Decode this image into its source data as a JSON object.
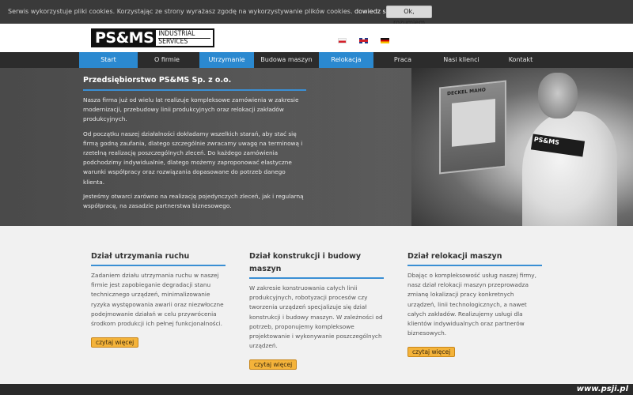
{
  "cookie": {
    "text": "Serwis wykorzystuje pliki cookies. Korzystając ze strony wyrażasz zgodę na wykorzystywanie plików cookies.",
    "link": "dowiedz się więcej.",
    "button": "Ok, rozumiem"
  },
  "header": {
    "logo_main": "PS&MS",
    "logo_line1": "INDUSTRIAL",
    "logo_line2": "SERVICES"
  },
  "nav": [
    {
      "label": "Start"
    },
    {
      "label": "O firmie"
    },
    {
      "label": "Utrzymanie ruchu"
    },
    {
      "label": "Budowa maszyn"
    },
    {
      "label": "Relokacja maszyn"
    },
    {
      "label": "Praca"
    },
    {
      "label": "Nasi klienci"
    },
    {
      "label": "Kontakt"
    }
  ],
  "hero": {
    "title": "Przedsiębiorstwo PS&MS Sp. z o.o.",
    "p1": "Nasza firma już od wielu lat realizuje kompleksowe zamówienia w zakresie modernizacji, przebudowy linii produkcyjnych oraz relokacji zakładów produkcyjnych.",
    "p2": "Od początku naszej działalności dokładamy wszelkich starań, aby stać się firmą godną zaufania, dlatego szczególnie zwracamy uwagę na terminową i rzetelną realizację poszczególnych zleceń. Do każdego zamówienia podchodzimy indywidualnie, dlatego możemy zaproponować elastyczne warunki współpracy oraz rozwiązania dopasowane do potrzeb danego klienta.",
    "p3": "Jesteśmy otwarci zarówno na realizację pojedynczych zleceń, jak i regularną współpracę, na zasadzie partnerstwa biznesowego.",
    "photo_machine_label": "DECKEL MAHO",
    "photo_patch": "PS&MS"
  },
  "columns": [
    {
      "title": "Dział utrzymania ruchu",
      "text": "Zadaniem działu utrzymania ruchu w naszej firmie jest zapobieganie degradacji stanu technicznego urządzeń, minimalizowanie ryzyka występowania awarii oraz niezwłoczne podejmowanie działań w celu przywrócenia środkom produkcji ich pełnej funkcjonalności.",
      "button": "czytaj więcej"
    },
    {
      "title": "Dział konstrukcji i budowy maszyn",
      "text": "W zakresie konstruowania całych linii produkcyjnych, robotyzacji procesów czy tworzenia urządzeń specjalizuje się dział konstrukcji i budowy maszyn. W zależności od potrzeb, proponujemy kompleksowe projektowanie i wykonywanie poszczególnych urządzeń.",
      "button": "czytaj więcej"
    },
    {
      "title": "Dział relokacji maszyn",
      "text": "Dbając o kompleksowość usług naszej firmy, nasz dział relokacji maszyn przeprowadza zmianę lokalizacji pracy konkretnych urządzeń, linii technologicznych, a nawet całych zakładów. Realizujemy usługi dla klientów indywidualnych oraz partnerów biznesowych.",
      "button": "czytaj więcej"
    }
  ],
  "watermark": "www.psji.pl"
}
